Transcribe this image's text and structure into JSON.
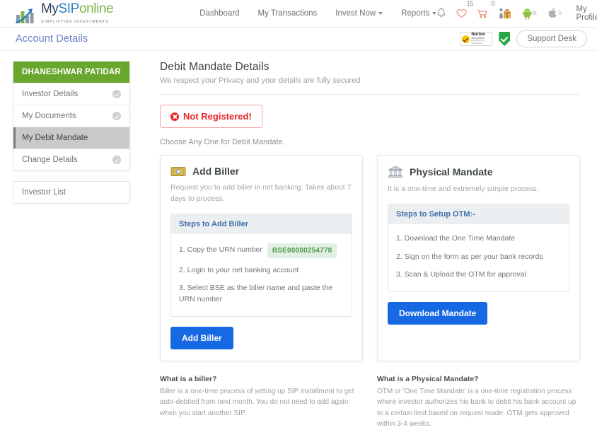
{
  "brand": {
    "word_my": "My",
    "word_sip": "SIP",
    "word_online": "online",
    "tagline": "SIMPLIFYING INVESTMENTS",
    "accent_green": "#7ab648",
    "accent_blue": "#2e7bbf",
    "dark_blue": "#2b3f5c"
  },
  "nav": {
    "items": [
      {
        "label": "Dashboard",
        "has_caret": false
      },
      {
        "label": "My Transactions",
        "has_caret": false
      },
      {
        "label": "Invest Now",
        "has_caret": true
      },
      {
        "label": "Reports",
        "has_caret": true
      }
    ],
    "wishlist_count": "15",
    "cart_count": "0",
    "profile_label": "My Profile"
  },
  "pagehead": {
    "title": "Account Details",
    "norton_title": "Norton",
    "norton_sub": "SECURED",
    "norton_footer": "powered by Symantec",
    "support_label": "Support Desk"
  },
  "sidebar": {
    "investor_name": "DHANESHWAR PATIDAR",
    "items": [
      {
        "label": "Investor Details",
        "checked": true,
        "active": false
      },
      {
        "label": "My Documents",
        "checked": true,
        "active": false
      },
      {
        "label": "My Debit Mandate",
        "checked": false,
        "active": true
      },
      {
        "label": "Change Details",
        "checked": true,
        "active": false
      }
    ],
    "investor_list_label": "Investor List"
  },
  "main": {
    "title": "Debit Mandate Details",
    "subtitle": "We respect your Privacy and your details are fully secured",
    "alert_text": "Not Registered!",
    "choose_text": "Choose Any One for Debit Mandate.",
    "card_biller": {
      "title": "Add Biller",
      "description": "Request you to add biller in net banking. Takes about 7 days to process.",
      "steps_title": "Steps to Add Biller",
      "step1_prefix": "1. Copy the URN number",
      "urn": "BSE00000254778",
      "step2": "2. Login to your net banking account",
      "step3": "3. Select BSE as the biller name and paste the URN number",
      "button": "Add Biller"
    },
    "card_physical": {
      "title": "Physical Mandate",
      "description": "It is a one-time and extremely simple process.",
      "steps_title": "Steps to Setup OTM:-",
      "step1": "1. Download the One Time Mandate",
      "step2": "2. Sign on the form as per your bank records",
      "step3": "3. Scan & Upload the OTM for approval",
      "button": "Download Mandate"
    },
    "note_biller": {
      "heading": "What is a biller?",
      "text": "Biller is a one-time process of setting up SIP installment to get auto-debited from next month. You do not need to add again when you start another SIP."
    },
    "note_physical": {
      "heading": "What is a Physical Mandate?",
      "text": "OTM or 'One Time Mandate' is a one-time registration process where investor authorizes his bank to debit his bank account up to a certain limit based on request made. OTM gets approved within 3-4 weeks."
    }
  },
  "colors": {
    "primary_button": "#1668e3",
    "sidebar_header": "#69a72e",
    "alert_red": "#e8252b",
    "urn_green": "#4a9a4a",
    "title_purple": "#6b7fc4"
  }
}
